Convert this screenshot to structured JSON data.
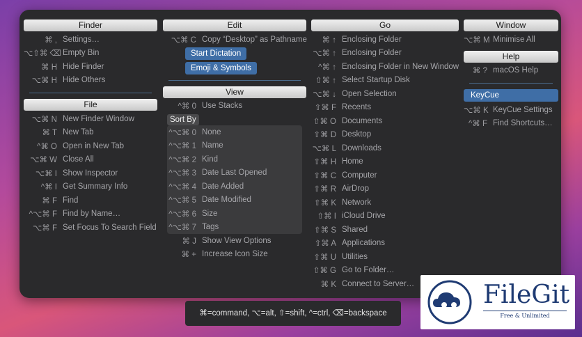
{
  "finder": {
    "header": "Finder",
    "items": [
      {
        "sc": "⌘ ,",
        "label": "Settings…"
      },
      {
        "sc": "⌥⇧⌘ ⌫",
        "label": "Empty Bin"
      },
      {
        "sc": "⌘ H",
        "label": "Hide Finder"
      },
      {
        "sc": "⌥⌘ H",
        "label": "Hide Others"
      }
    ]
  },
  "file": {
    "header": "File",
    "items": [
      {
        "sc": "⌥⌘ N",
        "label": "New Finder Window"
      },
      {
        "sc": "⌘ T",
        "label": "New Tab"
      },
      {
        "sc": "^⌘ O",
        "label": "Open in New Tab"
      },
      {
        "sc": "⌥⌘ W",
        "label": "Close All"
      },
      {
        "sc": "⌥⌘ I",
        "label": "Show Inspector"
      },
      {
        "sc": "^⌘ I",
        "label": "Get Summary Info"
      },
      {
        "sc": "⌘ F",
        "label": "Find"
      },
      {
        "sc": "^⌥⌘ F",
        "label": "Find by Name…"
      },
      {
        "sc": "⌥⌘ F",
        "label": "Set Focus To Search Field"
      }
    ]
  },
  "edit": {
    "header": "Edit",
    "items": [
      {
        "sc": "⌥⌘ C",
        "label": "Copy “Desktop” as Pathname"
      }
    ],
    "highlighted": [
      "Start Dictation",
      "Emoji & Symbols"
    ]
  },
  "view": {
    "header": "View",
    "stacks": {
      "sc": "^⌘ 0",
      "label": "Use Stacks"
    },
    "sortby_label": "Sort By",
    "sort_items": [
      {
        "sc": "^⌥⌘ 0",
        "label": "None"
      },
      {
        "sc": "^⌥⌘ 1",
        "label": "Name"
      },
      {
        "sc": "^⌥⌘ 2",
        "label": "Kind"
      },
      {
        "sc": "^⌥⌘ 3",
        "label": "Date Last Opened"
      },
      {
        "sc": "^⌥⌘ 4",
        "label": "Date Added"
      },
      {
        "sc": "^⌥⌘ 5",
        "label": "Date Modified"
      },
      {
        "sc": "^⌥⌘ 6",
        "label": "Size"
      },
      {
        "sc": "^⌥⌘ 7",
        "label": "Tags"
      }
    ],
    "after_items": [
      {
        "sc": "⌘ J",
        "label": "Show View Options"
      },
      {
        "sc": "⌘ +",
        "label": "Increase Icon Size"
      }
    ]
  },
  "go": {
    "header": "Go",
    "items": [
      {
        "sc": "⌘ ↑",
        "label": "Enclosing Folder"
      },
      {
        "sc": "⌥⌘ ↑",
        "label": "Enclosing Folder"
      },
      {
        "sc": "^⌘ ↑",
        "label": "Enclosing Folder in New Window"
      },
      {
        "sc": "⇧⌘ ↑",
        "label": "Select Startup Disk"
      },
      {
        "sc": "⌥⌘ ↓",
        "label": "Open Selection"
      },
      {
        "sc": "⇧⌘ F",
        "label": "Recents"
      },
      {
        "sc": "⇧⌘ O",
        "label": "Documents"
      },
      {
        "sc": "⇧⌘ D",
        "label": "Desktop"
      },
      {
        "sc": "⌥⌘ L",
        "label": "Downloads"
      },
      {
        "sc": "⇧⌘ H",
        "label": "Home"
      },
      {
        "sc": "⇧⌘ C",
        "label": "Computer"
      },
      {
        "sc": "⇧⌘ R",
        "label": "AirDrop"
      },
      {
        "sc": "⇧⌘ K",
        "label": "Network"
      },
      {
        "sc": "⇧⌘ I",
        "label": "iCloud Drive"
      },
      {
        "sc": "⇧⌘ S",
        "label": "Shared"
      },
      {
        "sc": "⇧⌘ A",
        "label": "Applications"
      },
      {
        "sc": "⇧⌘ U",
        "label": "Utilities"
      },
      {
        "sc": "⇧⌘ G",
        "label": "Go to Folder…"
      },
      {
        "sc": "⌘ K",
        "label": "Connect to Server…"
      }
    ]
  },
  "window": {
    "header": "Window",
    "items": [
      {
        "sc": "⌥⌘ M",
        "label": "Minimise All"
      }
    ]
  },
  "help": {
    "header": "Help",
    "items": [
      {
        "sc": "⌘ ?",
        "label": "macOS Help"
      }
    ]
  },
  "keycue": {
    "header": "KeyCue",
    "items": [
      {
        "sc": "⌥⌘ K",
        "label": "KeyCue Settings"
      },
      {
        "sc": "^⌘ F",
        "label": "Find Shortcuts…"
      }
    ]
  },
  "legend": "⌘=command, ⌥=alt, ⇧=shift, ^=ctrl, ⌫=backspace",
  "watermark": {
    "title": "FileGit",
    "subtitle": "Free & Unlimited"
  },
  "colors": {
    "accent": "#3f6ea6",
    "panel": "#2a2a2c",
    "brand": "#1f3b73"
  }
}
